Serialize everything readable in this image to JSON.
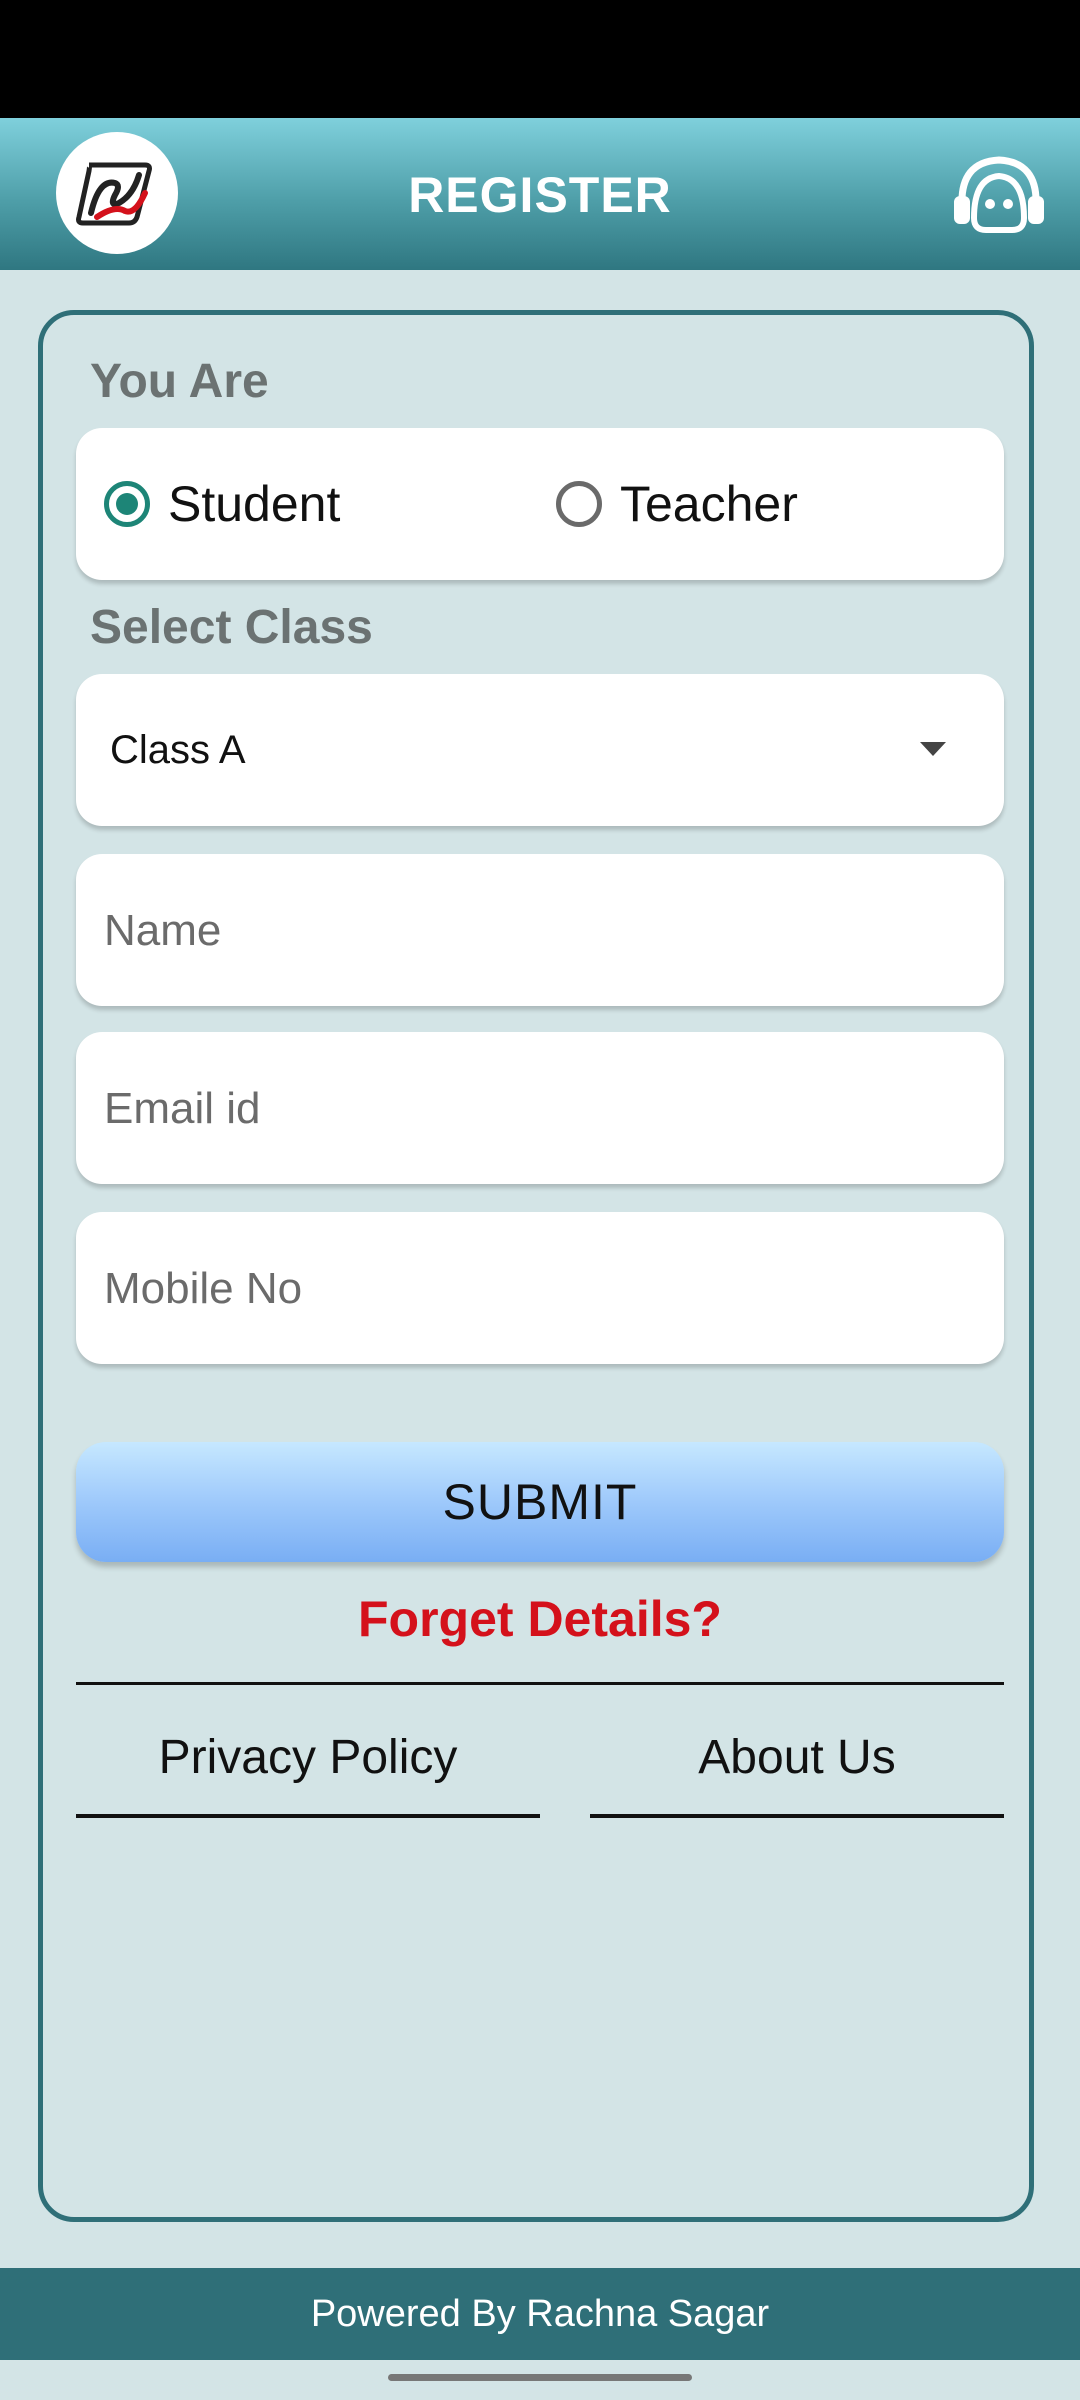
{
  "header": {
    "title": "REGISTER",
    "logo_icon": "rachna-sagar-logo-icon",
    "support_icon": "headset-support-icon"
  },
  "form": {
    "role_label": "You Are",
    "roles": [
      {
        "label": "Student",
        "selected": true
      },
      {
        "label": "Teacher",
        "selected": false
      }
    ],
    "class_label": "Select Class",
    "class_value": "Class A",
    "name_placeholder": "Name",
    "email_placeholder": "Email id",
    "mobile_placeholder": "Mobile No",
    "submit_label": "SUBMIT",
    "forget_label": "Forget Details?",
    "privacy_label": "Privacy Policy",
    "about_label": "About Us"
  },
  "footer": {
    "powered_by": "Powered By Rachna Sagar"
  },
  "colors": {
    "accent": "#2f6f78",
    "radio_checked": "#1d8577",
    "link_red": "#d4111b",
    "background": "#d3e4e6"
  }
}
